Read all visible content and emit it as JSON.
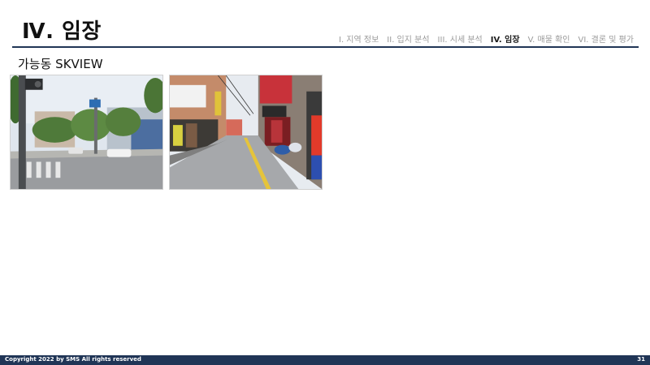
{
  "header": {
    "title": "Ⅳ. 임장",
    "nav": [
      {
        "label": "I. 지역 정보",
        "active": false
      },
      {
        "label": "II. 입지 분석",
        "active": false
      },
      {
        "label": "III. 시세 분석",
        "active": false
      },
      {
        "label": "IV. 임장",
        "active": true
      },
      {
        "label": "V. 매물 확인",
        "active": false
      },
      {
        "label": "VI. 결론 및 평가",
        "active": false
      }
    ]
  },
  "section": {
    "subtitle": "가능동 SKVIEW"
  },
  "footer": {
    "copyright": "Copyright 2022 by SMS All rights reserved",
    "page_number": "31"
  },
  "colors": {
    "accent": "#203556"
  }
}
